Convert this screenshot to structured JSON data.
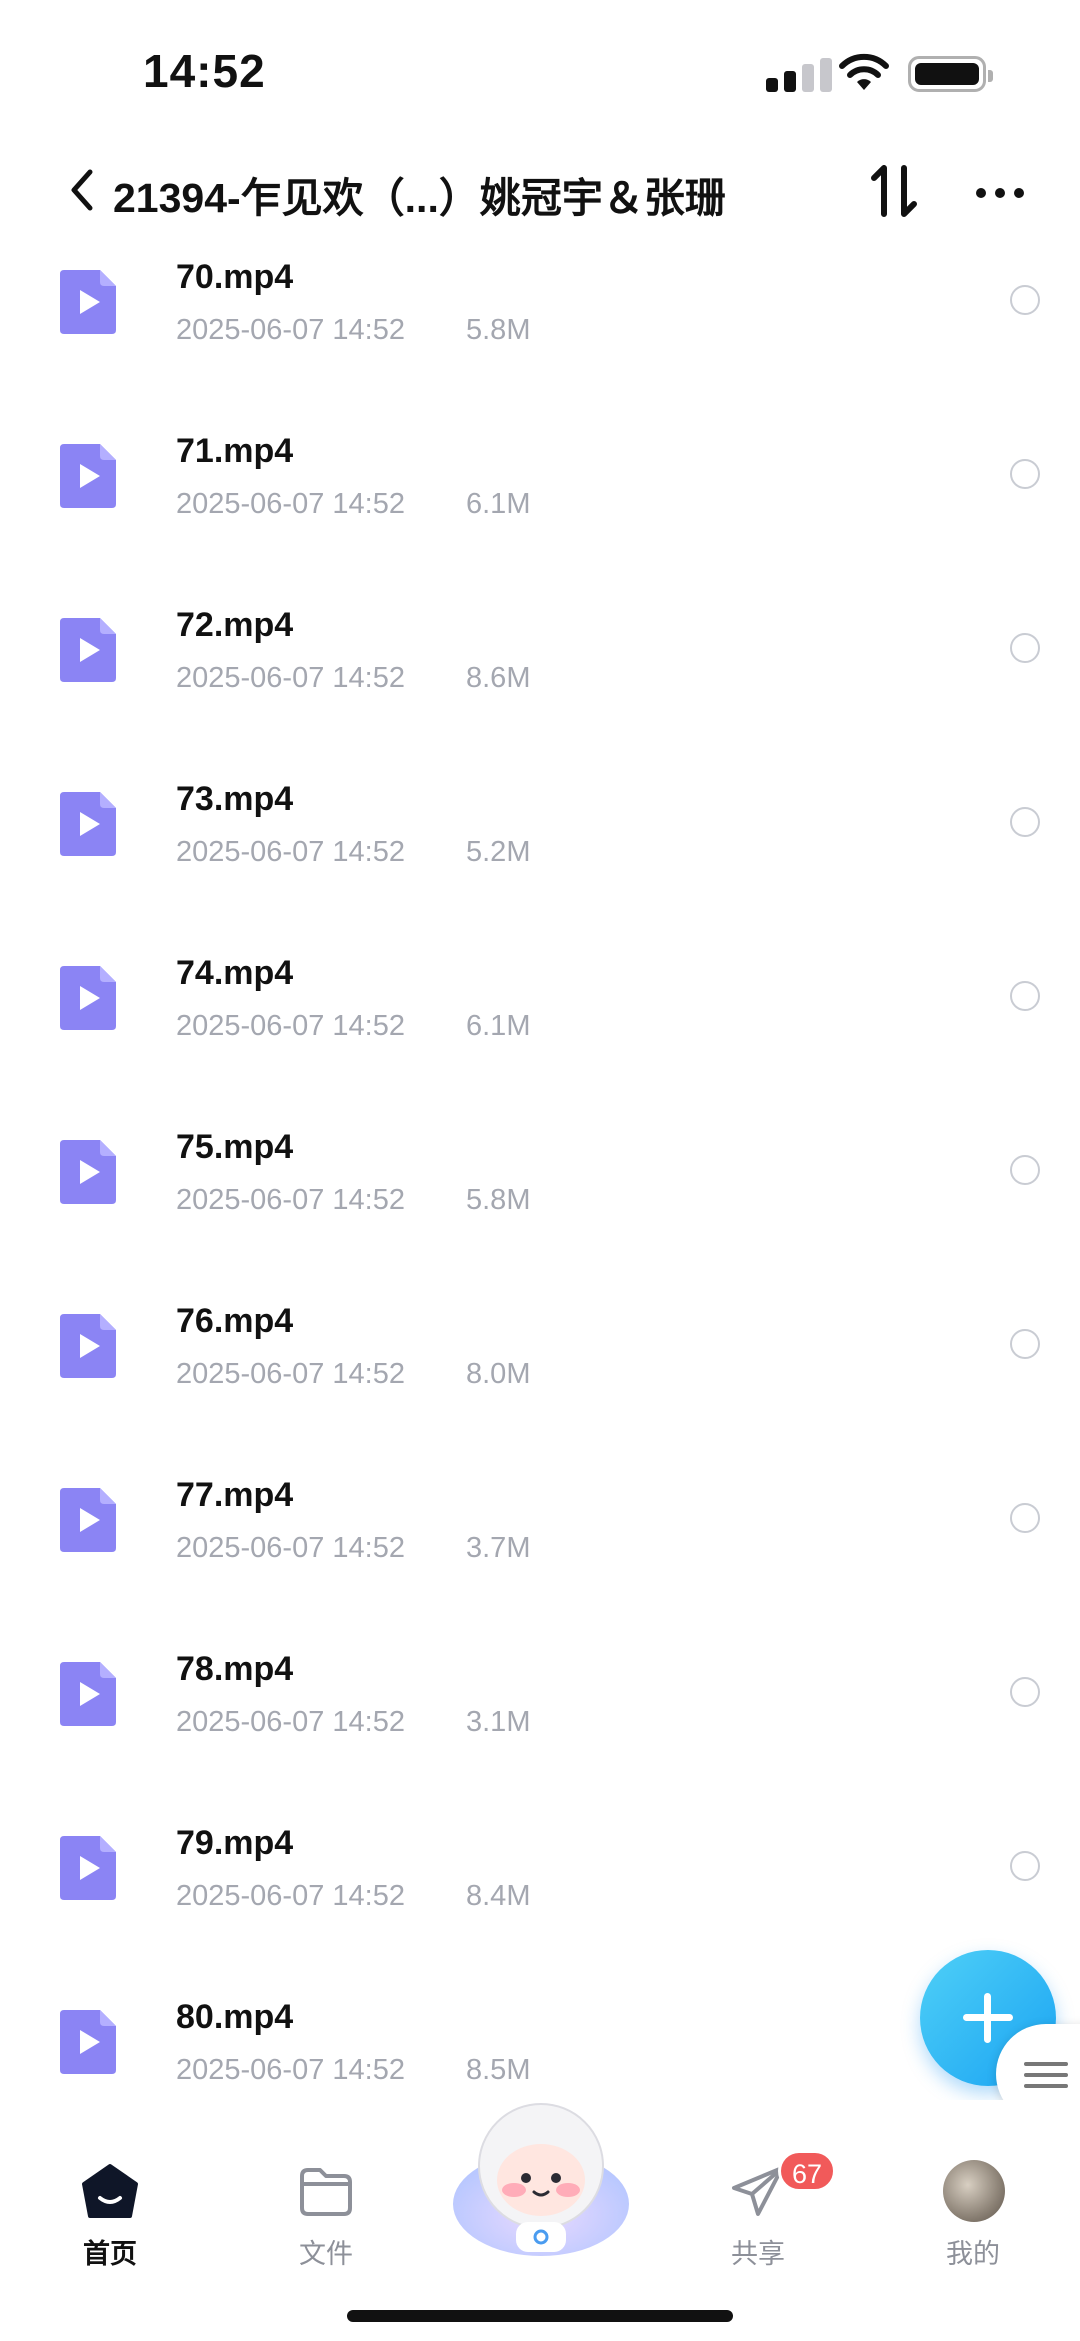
{
  "status_bar": {
    "time": "14:52"
  },
  "header": {
    "title": "21394-乍见欢（...）姚冠宇＆张珊"
  },
  "files": [
    {
      "name": "70.mp4",
      "date": "2025-06-07 14:52",
      "size": "5.8M"
    },
    {
      "name": "71.mp4",
      "date": "2025-06-07 14:52",
      "size": "6.1M"
    },
    {
      "name": "72.mp4",
      "date": "2025-06-07 14:52",
      "size": "8.6M"
    },
    {
      "name": "73.mp4",
      "date": "2025-06-07 14:52",
      "size": "5.2M"
    },
    {
      "name": "74.mp4",
      "date": "2025-06-07 14:52",
      "size": "6.1M"
    },
    {
      "name": "75.mp4",
      "date": "2025-06-07 14:52",
      "size": "5.8M"
    },
    {
      "name": "76.mp4",
      "date": "2025-06-07 14:52",
      "size": "8.0M"
    },
    {
      "name": "77.mp4",
      "date": "2025-06-07 14:52",
      "size": "3.7M"
    },
    {
      "name": "78.mp4",
      "date": "2025-06-07 14:52",
      "size": "3.1M"
    },
    {
      "name": "79.mp4",
      "date": "2025-06-07 14:52",
      "size": "8.4M"
    },
    {
      "name": "80.mp4",
      "date": "2025-06-07 14:52",
      "size": "8.5M"
    }
  ],
  "tabs": {
    "home": "首页",
    "files": "文件",
    "share": "共享",
    "share_badge": "67",
    "mine": "我的"
  },
  "colors": {
    "video_icon": "#8b84f4",
    "fab": "#22a9f4",
    "badge": "#f15a5a",
    "meta_text": "#a4a7b0"
  }
}
